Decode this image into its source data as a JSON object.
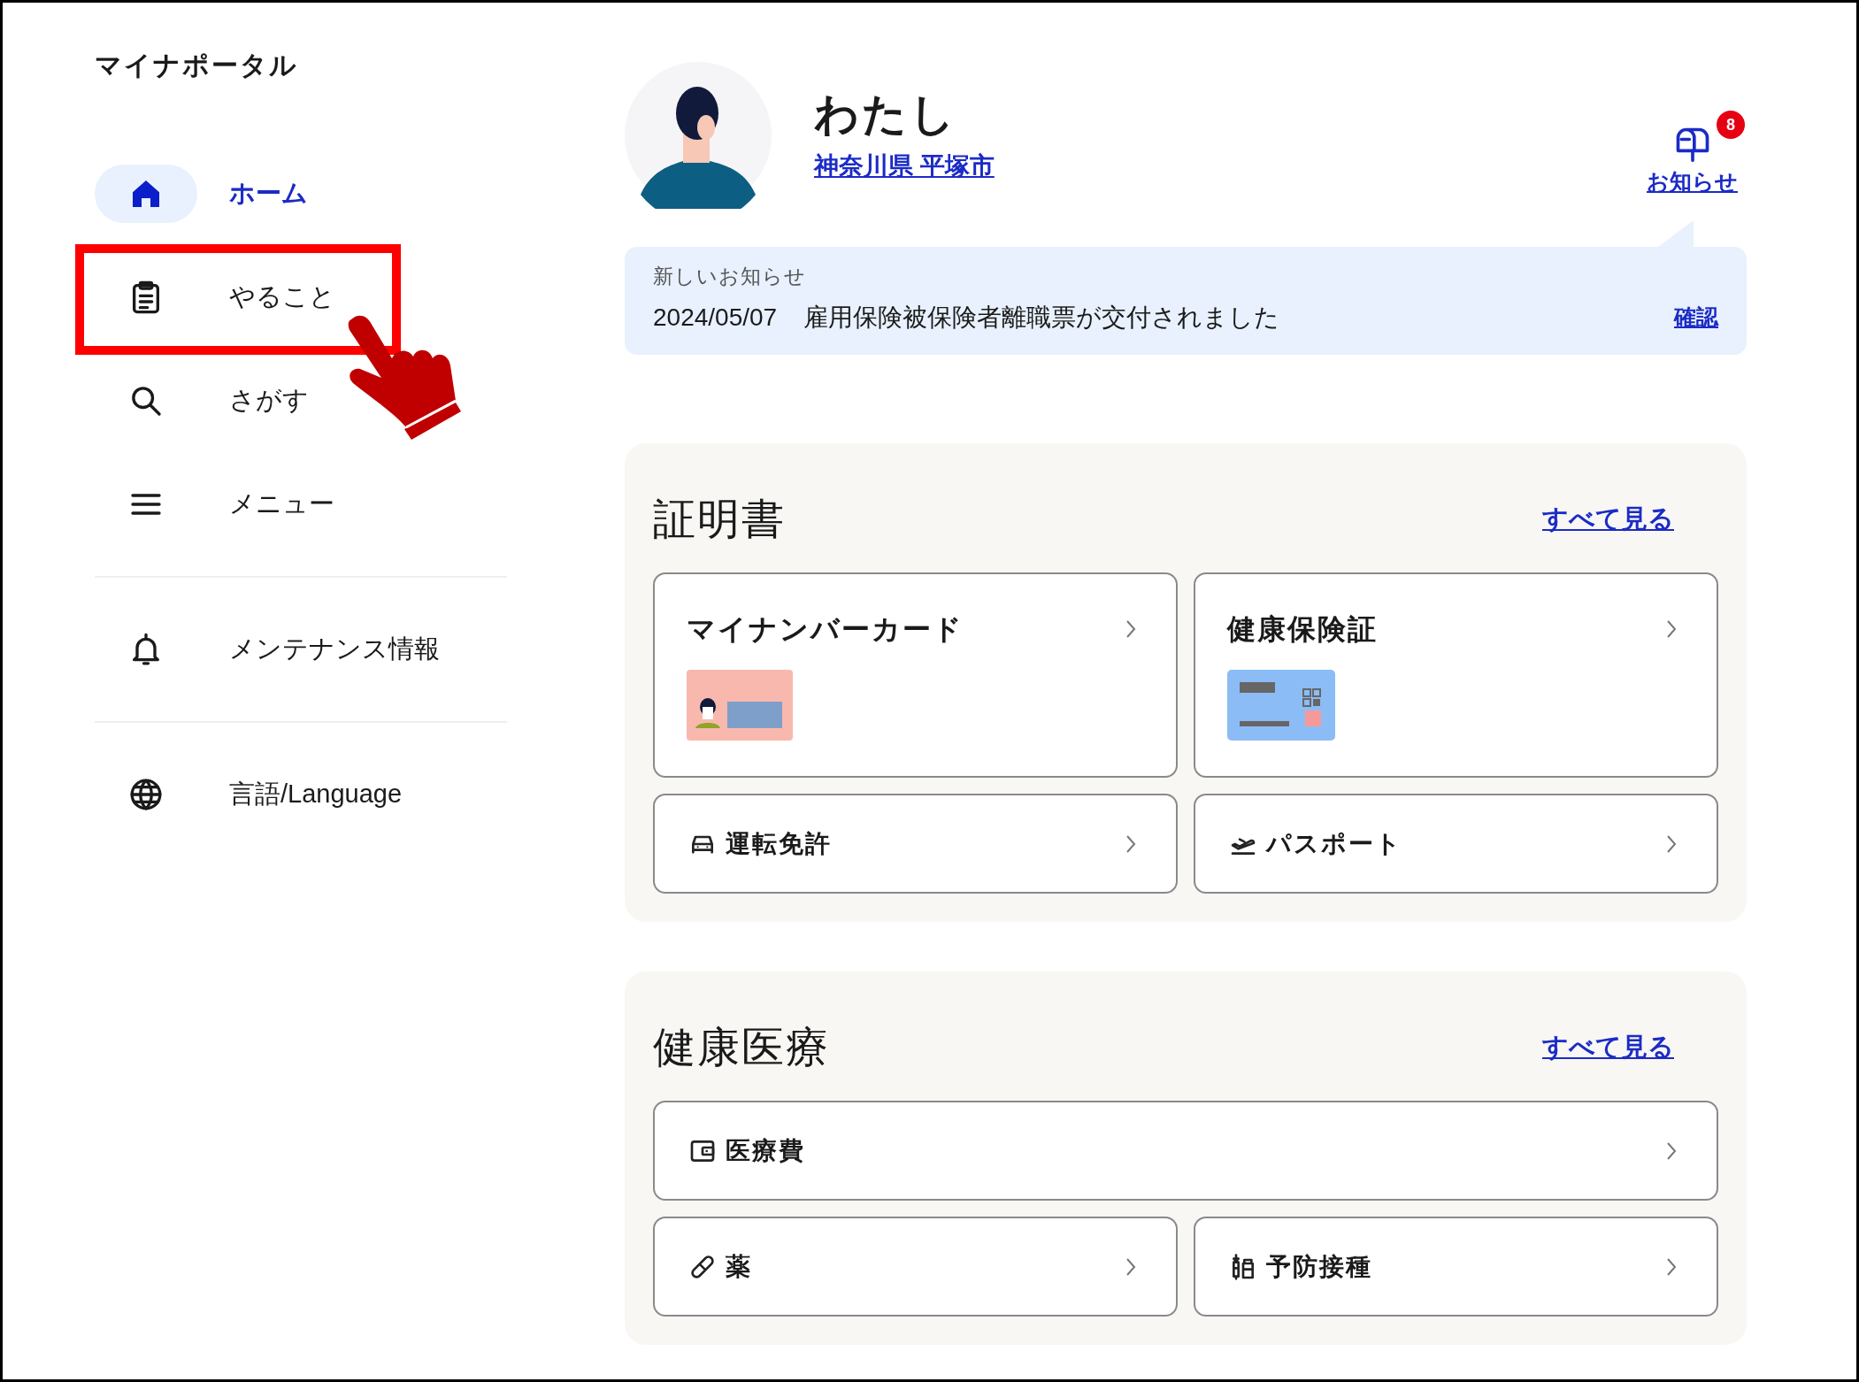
{
  "app_title": "マイナポータル",
  "nav_groups": [
    [
      {
        "label": "ホーム",
        "selected": true
      },
      {
        "label": "やること",
        "selected": false
      },
      {
        "label": "さがす",
        "selected": false
      },
      {
        "label": "メニュー",
        "selected": false
      }
    ],
    [
      {
        "label": "メンテナンス情報",
        "selected": false
      }
    ],
    [
      {
        "label": "言語/Language",
        "selected": false
      }
    ]
  ],
  "profile": {
    "name": "わたし",
    "location": "神奈川県 平塚市"
  },
  "notifications": {
    "label": "お知らせ",
    "count": "8"
  },
  "banner": {
    "heading": "新しいお知らせ",
    "date": "2024/05/07",
    "message": "雇用保険被保険者離職票が交付されました",
    "action": "確認"
  },
  "sections": [
    {
      "title": "証明書",
      "see_all": "すべて見る",
      "cards": [
        {
          "label": "マイナンバーカード",
          "kind": "card",
          "wide": false
        },
        {
          "label": "健康保険証",
          "kind": "card",
          "wide": false
        },
        {
          "label": "運転免許",
          "kind": "row",
          "wide": false
        },
        {
          "label": "パスポート",
          "kind": "row",
          "wide": false
        }
      ]
    },
    {
      "title": "健康医療",
      "see_all": "すべて見る",
      "cards": [
        {
          "label": "医療費",
          "kind": "row",
          "wide": true
        },
        {
          "label": "薬",
          "kind": "row",
          "wide": false
        },
        {
          "label": "予防接種",
          "kind": "row",
          "wide": false
        }
      ]
    }
  ]
}
